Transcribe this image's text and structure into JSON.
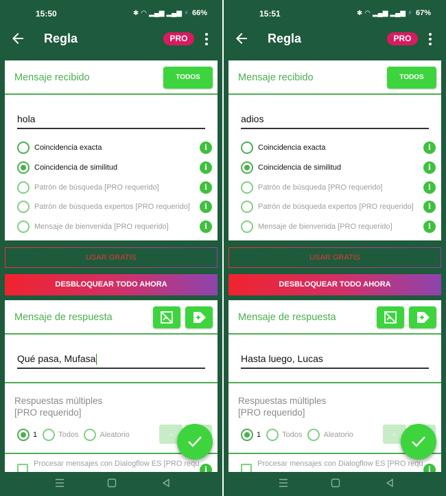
{
  "colors": {
    "background": "#1e5a3c",
    "accent": "#3ed43e",
    "label": "#4caf50",
    "pro_badge": "#d81b60",
    "usar_text": "#e53935",
    "unlock_gradient": [
      "#f0232f",
      "#8e44ad"
    ]
  },
  "screens": [
    {
      "status": {
        "time": "15:50",
        "battery": "66%"
      },
      "appbar": {
        "title": "Regla",
        "pro_badge": "PRO"
      },
      "received": {
        "header": "Mensaje recibido",
        "all_button": "TODOS",
        "input_value": "hola",
        "options": [
          {
            "label": "Coincidencia exacta",
            "selected": false,
            "enabled": true
          },
          {
            "label": "Coincidencia de similitud",
            "selected": true,
            "enabled": true
          },
          {
            "label": "Patrón de búsqueda [PRO requerido]",
            "selected": false,
            "enabled": false
          },
          {
            "label": "Patrón de búsqueda expertos [PRO requerido]",
            "selected": false,
            "enabled": false
          },
          {
            "label": "Mensaje de bienvenida [PRO requerido]",
            "selected": false,
            "enabled": false
          }
        ]
      },
      "usar_gratis": "USAR GRATIS",
      "unlock": "DESBLOQUEAR TODO AHORA",
      "reply": {
        "header": "Mensaje de respuesta",
        "input_value": "Qué pasa, Mufasa"
      },
      "multi": {
        "title_line1": "Respuestas múltiples",
        "title_line2": "[PRO requerido]",
        "option_1": "1",
        "option_all": "Todos",
        "option_random": "Aleatorio",
        "minus": "-"
      },
      "dialogflow": "Procesar mensajes con Dialogflow ES [PRO requerido]"
    },
    {
      "status": {
        "time": "15:51",
        "battery": "67%"
      },
      "appbar": {
        "title": "Regla",
        "pro_badge": "PRO"
      },
      "received": {
        "header": "Mensaje recibido",
        "all_button": "TODOS",
        "input_value": "adios",
        "options": [
          {
            "label": "Coincidencia exacta",
            "selected": false,
            "enabled": true
          },
          {
            "label": "Coincidencia de similitud",
            "selected": true,
            "enabled": true
          },
          {
            "label": "Patrón de búsqueda [PRO requerido]",
            "selected": false,
            "enabled": false
          },
          {
            "label": "Patrón de búsqueda expertos [PRO requerido]",
            "selected": false,
            "enabled": false
          },
          {
            "label": "Mensaje de bienvenida [PRO requerido]",
            "selected": false,
            "enabled": false
          }
        ]
      },
      "usar_gratis": "USAR GRATIS",
      "unlock": "DESBLOQUEAR TODO AHORA",
      "reply": {
        "header": "Mensaje de respuesta",
        "input_value": "Hasta luego, Lucas"
      },
      "multi": {
        "title_line1": "Respuestas múltiples",
        "title_line2": "[PRO requerido]",
        "option_1": "1",
        "option_all": "Todos",
        "option_random": "Aleatorio",
        "minus": "-"
      },
      "dialogflow": "Procesar mensajes con Dialogflow ES [PRO requerido]"
    }
  ],
  "icons": {
    "back": "arrow-left-icon",
    "more": "more-vert-icon",
    "info": "info-icon",
    "no_image": "image-off-icon",
    "add_tag": "tag-add-icon",
    "confirm": "check-icon",
    "nav_menu": "menu-icon",
    "nav_home": "square-home-icon",
    "nav_back": "triangle-back-icon"
  },
  "info_glyph": "i"
}
